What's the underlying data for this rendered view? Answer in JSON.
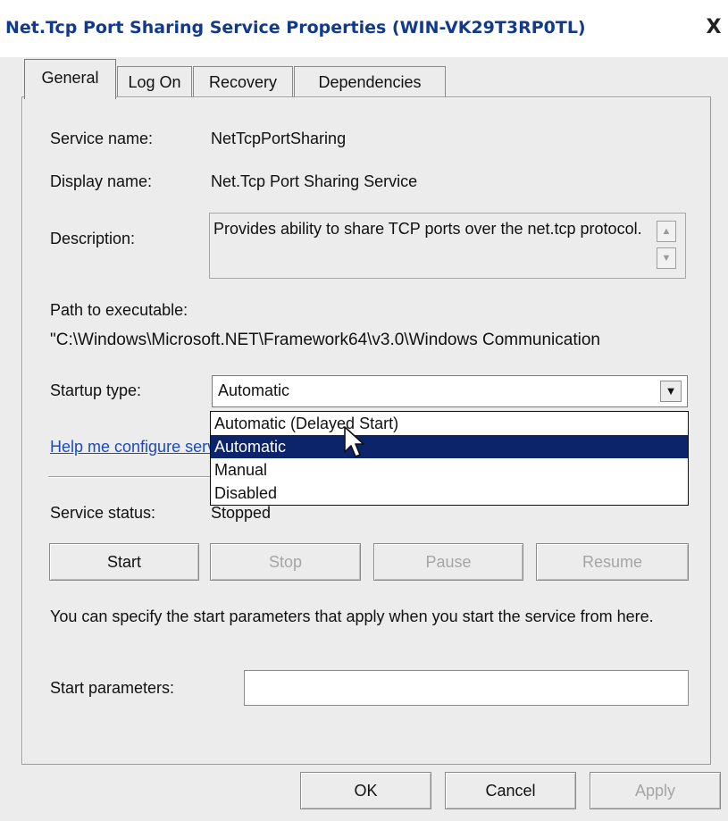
{
  "window": {
    "title": "Net.Tcp Port Sharing Service Properties (WIN-VK29T3RP0TL)",
    "close_glyph": "X"
  },
  "tabs": [
    {
      "label": "General",
      "active": true
    },
    {
      "label": "Log On",
      "active": false
    },
    {
      "label": "Recovery",
      "active": false
    },
    {
      "label": "Dependencies",
      "active": false
    }
  ],
  "general": {
    "service_name_label": "Service name:",
    "service_name_value": "NetTcpPortSharing",
    "display_name_label": "Display name:",
    "display_name_value": "Net.Tcp Port Sharing Service",
    "description_label": "Description:",
    "description_value": "Provides ability to share TCP ports over the net.tcp protocol.",
    "path_label": "Path to executable:",
    "path_value": "\"C:\\Windows\\Microsoft.NET\\Framework64\\v3.0\\Windows Communication",
    "startup_type_label": "Startup type:",
    "startup_type_value": "Automatic",
    "startup_options": [
      {
        "label": "Automatic (Delayed Start)",
        "selected": false
      },
      {
        "label": "Automatic",
        "selected": true
      },
      {
        "label": "Manual",
        "selected": false
      },
      {
        "label": "Disabled",
        "selected": false
      }
    ],
    "help_link": "Help me configure service startup options.",
    "service_status_label": "Service status:",
    "service_status_value": "Stopped",
    "buttons": {
      "start": "Start",
      "stop": "Stop",
      "pause": "Pause",
      "resume": "Resume"
    },
    "start_params_info": "You can specify the start parameters that apply when you start the service from here.",
    "start_params_label": "Start parameters:",
    "start_params_value": ""
  },
  "footer": {
    "ok": "OK",
    "cancel": "Cancel",
    "apply": "Apply"
  },
  "colors": {
    "title_text": "#123a8c",
    "selection": "#0c246a",
    "link": "#1b4ac0"
  }
}
